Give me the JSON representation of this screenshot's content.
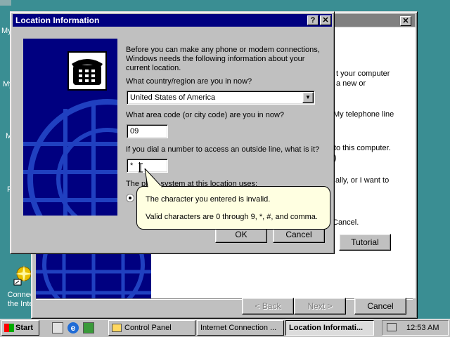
{
  "desktop": {
    "icon_labels": [
      "My",
      "My",
      "M",
      "R"
    ],
    "connect_label_line1": "Connect",
    "connect_label_line2": "the Inter"
  },
  "bg_window": {
    "close_glyph": "✕",
    "text_lines": [
      "t your computer",
      "a new or",
      "My telephone line",
      "to this computer.",
      ")",
      "ally, or I want to",
      "Cancel."
    ],
    "tutorial_label": "Tutorial",
    "back_label": "< Back",
    "next_label": "Next >",
    "cancel_label": "Cancel"
  },
  "dialog": {
    "title": "Location Information",
    "help_glyph": "?",
    "close_glyph": "✕",
    "intro": "Before you can make any phone or modem connections, Windows needs the following information about your current location.",
    "country_question": "What country/region are you in now?",
    "country_value": "United States of America",
    "area_code_question": "What area code (or city code) are you in now?",
    "area_code_value": "09",
    "outside_line_question": "If you dial a number to access an outside line, what is it?",
    "outside_line_value": "*",
    "phone_system_label_a": "The ph",
    "phone_system_label_b": "ne system at this location uses:",
    "ok_label": "OK",
    "cancel_label": "Cancel"
  },
  "tooltip": {
    "line1": "The character you entered is invalid.",
    "line2": "Valid characters are 0 through 9, *, #, and comma."
  },
  "taskbar": {
    "start_label": "Start",
    "tasks": [
      "Control Panel",
      "Internet Connection ...",
      "Location Informati..."
    ],
    "clock": "12:53 AM"
  }
}
